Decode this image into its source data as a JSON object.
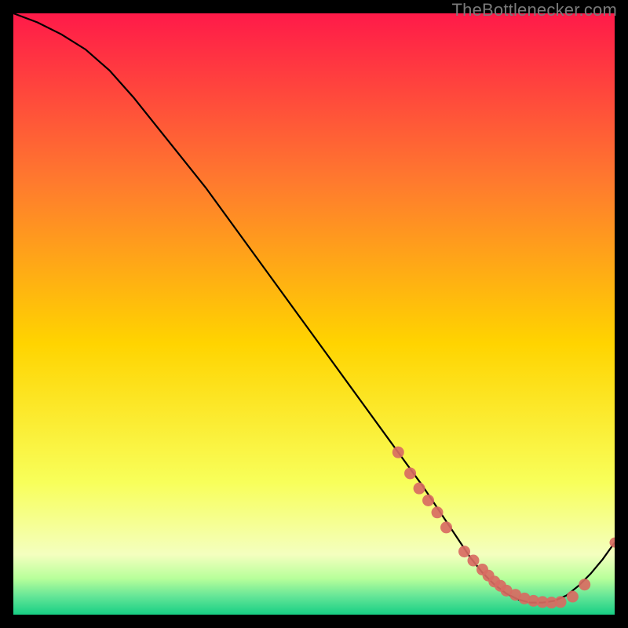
{
  "watermark": "TheBottlenecker.com",
  "colors": {
    "grad_top": "#ff1a49",
    "grad_mid_upper": "#ff7a2e",
    "grad_mid": "#ffd400",
    "grad_mid_lower": "#f8ff5a",
    "grad_pale": "#f4ffbf",
    "grad_green1": "#b7ff9a",
    "grad_green2": "#63e597",
    "grad_green3": "#17cf84",
    "line": "#000000",
    "marker": "#d86b62"
  },
  "chart_data": {
    "type": "line",
    "title": "",
    "xlabel": "",
    "ylabel": "",
    "xlim": [
      0,
      100
    ],
    "ylim": [
      0,
      100
    ],
    "series": [
      {
        "name": "bottleneck-curve",
        "x": [
          0,
          4,
          8,
          12,
          16,
          20,
          24,
          28,
          32,
          36,
          40,
          44,
          48,
          52,
          56,
          60,
          64,
          68,
          70,
          72,
          74,
          76,
          78,
          80,
          82,
          84,
          86,
          88,
          90,
          92,
          94,
          96,
          98,
          100
        ],
        "y": [
          100,
          98.5,
          96.5,
          94,
          90.5,
          86,
          81,
          76,
          71,
          65.5,
          60,
          54.5,
          49,
          43.5,
          38,
          32.5,
          27,
          21.5,
          18.5,
          15.5,
          12.5,
          9.5,
          7.0,
          5.0,
          3.5,
          2.5,
          2.0,
          2.0,
          2.3,
          3.2,
          4.8,
          6.8,
          9.2,
          12.0
        ]
      }
    ],
    "markers": {
      "name": "highlight-points",
      "x": [
        64,
        66,
        67.5,
        69,
        70.5,
        72,
        75,
        76.5,
        78,
        79,
        80,
        81,
        82,
        83.5,
        85,
        86.5,
        88,
        89.5,
        91,
        93,
        95,
        100
      ],
      "y": [
        27,
        23.5,
        21,
        19,
        17,
        14.5,
        10.5,
        9,
        7.5,
        6.5,
        5.5,
        4.8,
        4.0,
        3.3,
        2.7,
        2.3,
        2.1,
        2.0,
        2.1,
        3.0,
        5.0,
        12.0
      ]
    }
  }
}
